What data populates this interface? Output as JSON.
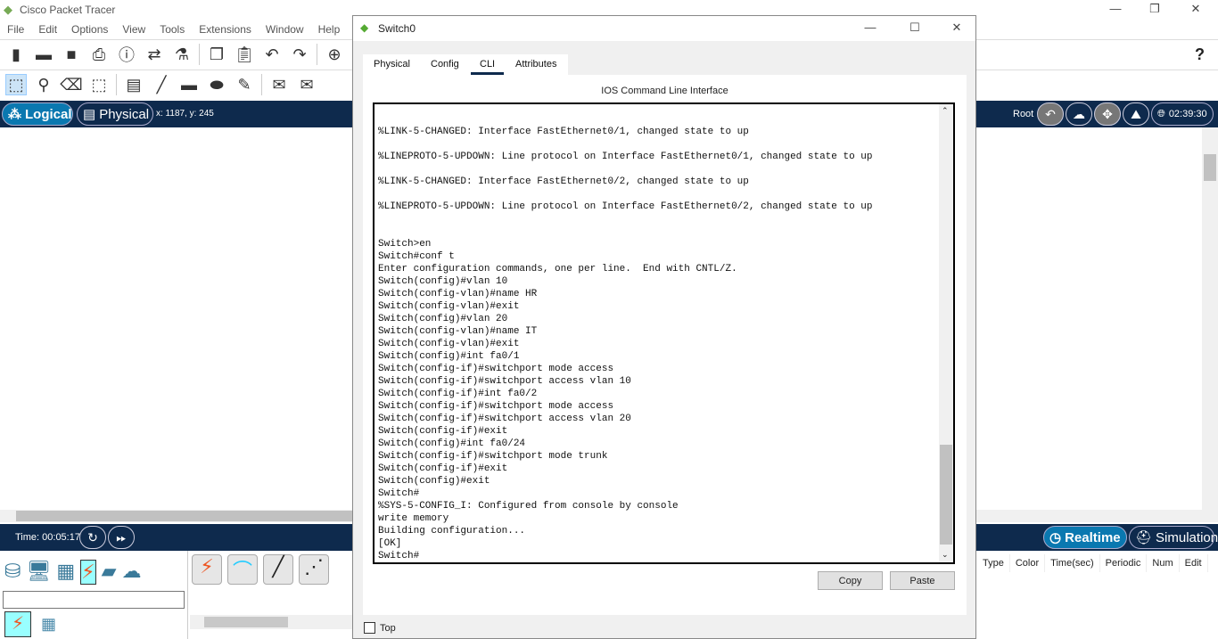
{
  "app": {
    "title": "Cisco Packet Tracer",
    "menu": [
      "File",
      "Edit",
      "Options",
      "View",
      "Tools",
      "Extensions",
      "Window",
      "Help"
    ],
    "help": "?"
  },
  "workspace": {
    "logical": "Logical",
    "physical": "Physical",
    "coords": "x: 1187, y: 245",
    "root": "Root",
    "clock": "02:39:30"
  },
  "timebar": {
    "time": "Time: 00:05:17",
    "realtime": "Realtime",
    "simulation": "Simulation"
  },
  "pdu_table": {
    "columns": [
      "Type",
      "Color",
      "Time(sec)",
      "Periodic",
      "Num",
      "Edit"
    ]
  },
  "dialog": {
    "title": "Switch0",
    "tabs": [
      "Physical",
      "Config",
      "CLI",
      "Attributes"
    ],
    "active_tab": "CLI",
    "heading": "IOS Command Line Interface",
    "copy": "Copy",
    "paste": "Paste",
    "top": "Top",
    "cli_lines": [
      "",
      "%LINK-5-CHANGED: Interface FastEthernet0/1, changed state to up",
      "",
      "%LINEPROTO-5-UPDOWN: Line protocol on Interface FastEthernet0/1, changed state to up",
      "",
      "%LINK-5-CHANGED: Interface FastEthernet0/2, changed state to up",
      "",
      "%LINEPROTO-5-UPDOWN: Line protocol on Interface FastEthernet0/2, changed state to up",
      "",
      "",
      "Switch>en",
      "Switch#conf t",
      "Enter configuration commands, one per line.  End with CNTL/Z.",
      "Switch(config)#vlan 10",
      "Switch(config-vlan)#name HR",
      "Switch(config-vlan)#exit",
      "Switch(config)#vlan 20",
      "Switch(config-vlan)#name IT",
      "Switch(config-vlan)#exit",
      "Switch(config)#int fa0/1",
      "Switch(config-if)#switchport mode access",
      "Switch(config-if)#switchport access vlan 10",
      "Switch(config-if)#int fa0/2",
      "Switch(config-if)#switchport mode access",
      "Switch(config-if)#switchport access vlan 20",
      "Switch(config-if)#exit",
      "Switch(config)#int fa0/24",
      "Switch(config-if)#switchport mode trunk",
      "Switch(config-if)#exit",
      "Switch(config)#exit",
      "Switch#",
      "%SYS-5-CONFIG_I: Configured from console by console",
      "write memory",
      "Building configuration...",
      "[OK]",
      "Switch#"
    ]
  }
}
